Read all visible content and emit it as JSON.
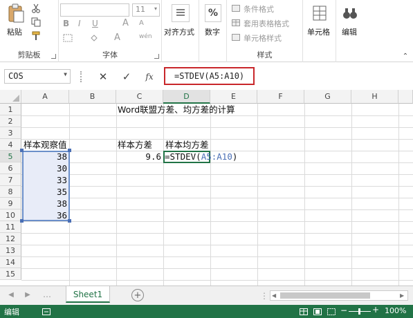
{
  "ribbon": {
    "clipboard": {
      "paste_label": "粘贴",
      "group_label": "剪贴板"
    },
    "font": {
      "font_size": "11",
      "bold": "B",
      "italic": "I",
      "underline": "U",
      "grow": "A",
      "shrink": "A",
      "color_a": "A",
      "phonetic": "wén",
      "group_label": "字体"
    },
    "alignment": {
      "label": "对齐方式"
    },
    "number": {
      "label": "数字",
      "glyph": "%"
    },
    "styles": {
      "conditional": "条件格式",
      "table_format": "套用表格格式",
      "cell_styles": "单元格样式",
      "group_label": "样式"
    },
    "cells": {
      "label": "单元格"
    },
    "editing": {
      "label": "编辑"
    }
  },
  "formula_bar": {
    "name_box": "COS",
    "cancel": "✕",
    "enter": "✓",
    "fx": "fx",
    "formula": "=STDEV(A5:A10)"
  },
  "columns": [
    "A",
    "B",
    "C",
    "D",
    "E",
    "F",
    "G",
    "H"
  ],
  "rows": [
    "1",
    "2",
    "3",
    "4",
    "5",
    "6",
    "7",
    "8",
    "9",
    "10",
    "11",
    "12",
    "13",
    "14",
    "15"
  ],
  "cells": {
    "C1": "Word联盟方差、均方差的计算",
    "A4": "样本观察值",
    "C4": "样本方差",
    "D4": "样本均方差",
    "A5": "38",
    "A6": "30",
    "A7": "33",
    "A8": "35",
    "A9": "38",
    "A10": "36",
    "C5": "9.6",
    "D5_prefix": "=STDEV(",
    "D5_ref": "A5:A10",
    "D5_suffix": ")"
  },
  "sheet": {
    "tab": "Sheet1",
    "add": "+"
  },
  "status": {
    "mode": "编辑",
    "zoom": "100%"
  },
  "colors": {
    "excel_green": "#217346",
    "formula_highlight": "#c8262a",
    "range_border": "#6b8fc9"
  }
}
